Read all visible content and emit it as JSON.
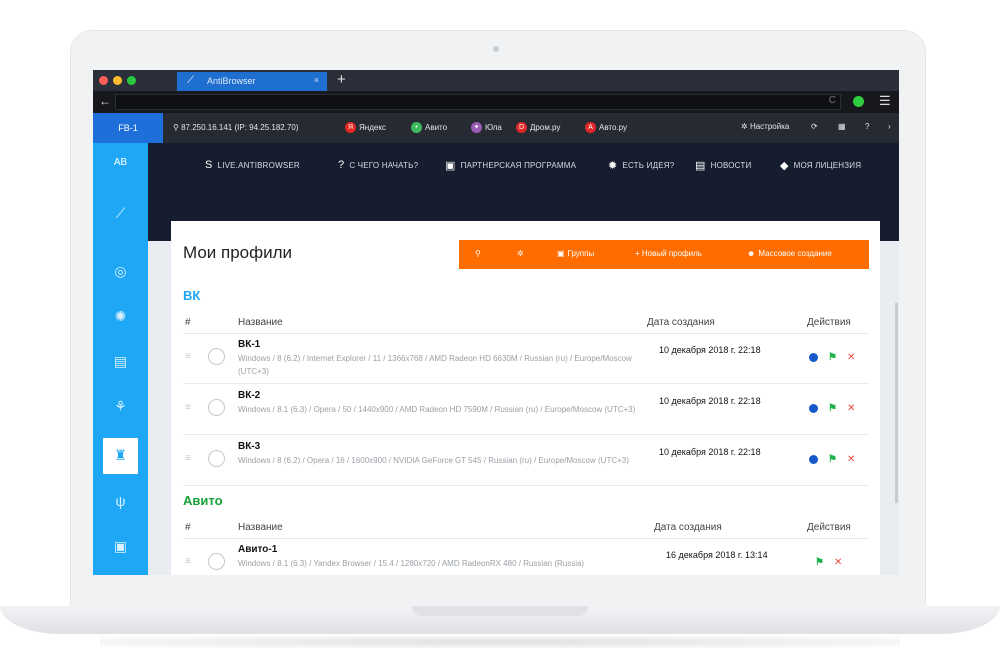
{
  "browser": {
    "tab_title": "AntiBrowser",
    "tab_close": "×",
    "new_tab": "+",
    "back": "←",
    "menu_glyph": "☰",
    "reload_glyph": "C",
    "traffic_colors": [
      "#ff5f57",
      "#febc2e",
      "#28c840"
    ]
  },
  "bookmarks": {
    "profile_tag": "FB-1",
    "ip": "87.250.16.141 (IP: 94.25.182.70)",
    "items": [
      {
        "label": "Яндекс",
        "icon": "yandex-icon",
        "glyph": "Я",
        "color": "#e52620"
      },
      {
        "label": "Авито",
        "icon": "avito-icon",
        "glyph": "•",
        "color": "#3dbb5c"
      },
      {
        "label": "Юла",
        "icon": "youla-icon",
        "glyph": "✦",
        "color": "#9b59b6"
      },
      {
        "label": "Дром.ру",
        "icon": "drom-icon",
        "glyph": "D",
        "color": "#e02828"
      },
      {
        "label": "Авто.ру",
        "icon": "autoru-icon",
        "glyph": "A",
        "color": "#e02828"
      }
    ],
    "settings": "Настройка"
  },
  "sidebar": {
    "ab": "AB",
    "icons": [
      "telescope-icon",
      "target-icon",
      "globe-icon",
      "document-icon",
      "network-icon",
      "spy-icon",
      "plug-icon",
      "robot-icon"
    ]
  },
  "topnav": [
    {
      "label": "LIVE.ANTIBROWSER",
      "icon": "skype-icon",
      "glyph": "S"
    },
    {
      "label": "С ЧЕГО НАЧАТЬ?",
      "icon": "question-icon",
      "glyph": "?"
    },
    {
      "label": "ПАРТНЕРСКАЯ ПРОГРАММА",
      "icon": "camera-icon",
      "glyph": "▣"
    },
    {
      "label": "ЕСТЬ ИДЕЯ?",
      "icon": "bulb-icon",
      "glyph": "✹"
    },
    {
      "label": "НОВОСТИ",
      "icon": "news-icon",
      "glyph": "▤"
    },
    {
      "label": "МОЯ ЛИЦЕНЗИЯ",
      "icon": "shield-icon",
      "glyph": "◆"
    }
  ],
  "main": {
    "title": "Мои профили",
    "toolbar": {
      "groups": "Группы",
      "new_profile": "+ Новый профиль",
      "bulk_create": "Массовое создание"
    },
    "accent": "#ff6d00",
    "sections": [
      {
        "name": "ВК",
        "color": "#1ea7f4",
        "headers": {
          "num": "#",
          "name": "Название",
          "date": "Дата создания",
          "actions": "Действия"
        },
        "rows": [
          {
            "name": "ВК-1",
            "desc": "Windows / 8 (6.2) / Internet Explorer / 11 / 1366x768 / AMD Radeon HD 6630M / Russian (ru) / Europe/Moscow (UTC+3)",
            "date": "10 декабря 2018 г. 22:18"
          },
          {
            "name": "ВК-2",
            "desc": "Windows / 8.1 (6.3) / Opera / 50 / 1440x900 / AMD Radeon HD 7590M / Russian (ru) / Europe/Moscow (UTC+3)",
            "date": "10 декабря 2018 г. 22:18"
          },
          {
            "name": "ВК-3",
            "desc": "Windows / 8 (6.2) / Opera / 16 / 1600x900 / NVIDIA GeForce GT 545 / Russian (ru) / Europe/Moscow (UTC+3)",
            "date": "10 декабря 2018 г. 22:18"
          }
        ]
      },
      {
        "name": "Авито",
        "color": "#19a33a",
        "headers": {
          "num": "#",
          "name": "Название",
          "date": "Дата создания",
          "actions": "Действия"
        },
        "rows": [
          {
            "name": "Авито-1",
            "desc": "Windows / 8.1 (6.3) / Yandex Browser / 15.4 / 1280x720 / AMD RadeonRX 480 / Russian (Russia)",
            "date": "16 декабря 2018 г. 13:14"
          }
        ]
      }
    ]
  }
}
